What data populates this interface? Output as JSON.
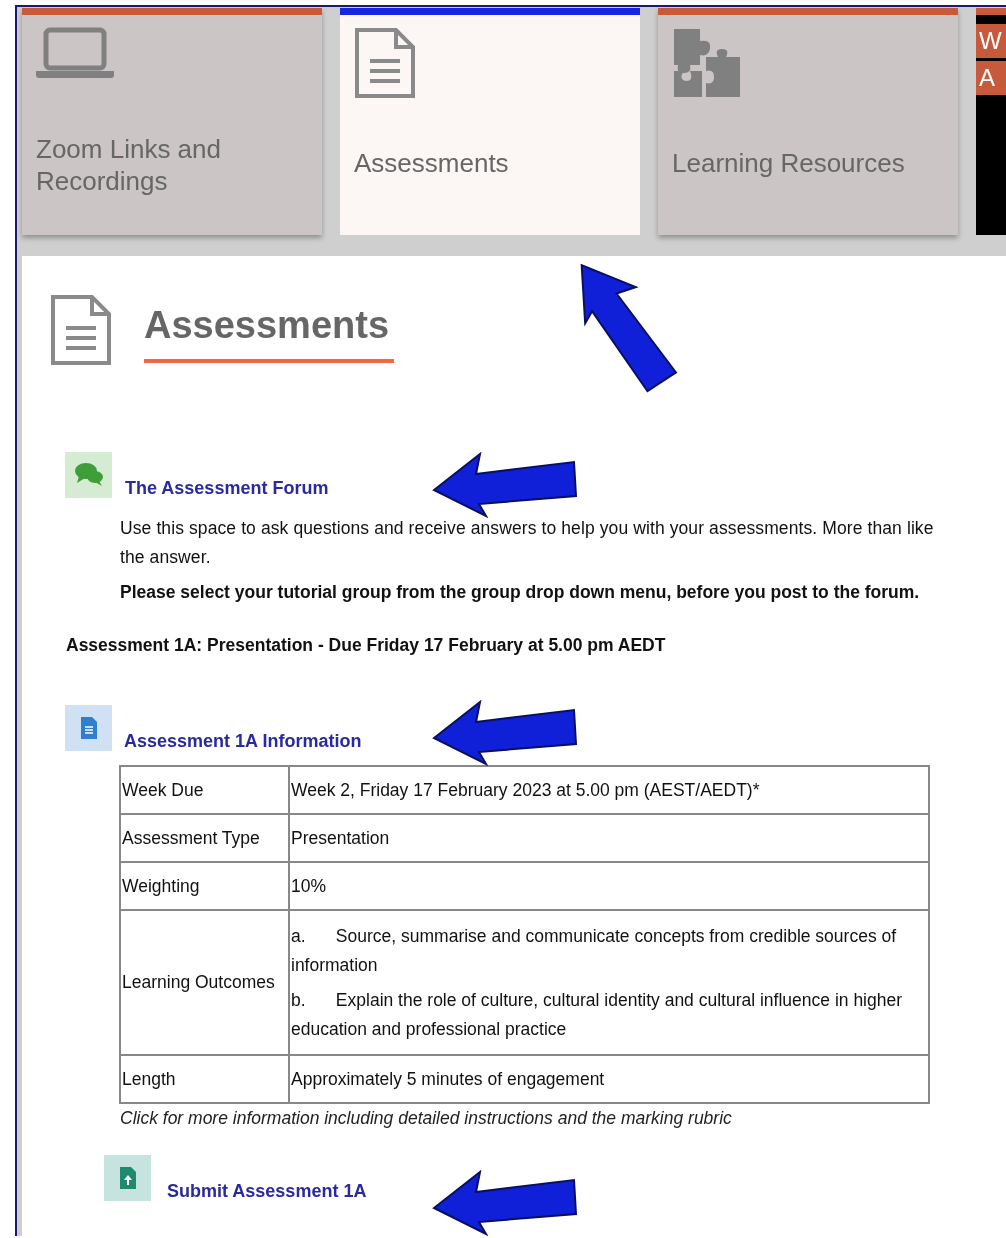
{
  "tabs": [
    {
      "kind": "laptop",
      "label": "Zoom Links and Recordings",
      "selected": false
    },
    {
      "kind": "page",
      "label": "Assessments",
      "selected": true
    },
    {
      "kind": "puzzle",
      "label": "Learning Resources",
      "selected": false
    },
    {
      "kind": "cut",
      "lines": [
        "W",
        "A"
      ],
      "selected": false
    }
  ],
  "heading": "Assessments",
  "forum": {
    "link": "The Assessment Forum",
    "lines": [
      "Use this space to ask questions and receive answers to help you with your assessments. More than like",
      "the answer."
    ],
    "notice": "Please select your tutorial group from the group drop down menu, before you post to the forum."
  },
  "assessment_title": "Assessment 1A: Presentation - Due Friday 17 February at 5.00 pm AEDT",
  "info_link": "Assessment 1A Information",
  "table": {
    "rows": [
      {
        "kind": "text",
        "label": "Week Due",
        "value": "Week 2, Friday 17 February 2023 at 5.00 pm (AEST/AEDT)*"
      },
      {
        "kind": "text",
        "label": "Assessment Type",
        "value": "Presentation"
      },
      {
        "kind": "text",
        "label": "Weighting",
        "value": "10%"
      },
      {
        "kind": "list",
        "label": "Learning Outcomes",
        "items": [
          {
            "marker": "a.",
            "text": "Source, summarise and communicate concepts from credible sources of information"
          },
          {
            "marker": "b.",
            "text": "Explain the role of culture, cultural identity and cultural influence in higher education and professional practice"
          }
        ]
      },
      {
        "kind": "text",
        "label": "Length",
        "value": "Approximately 5 minutes of engagement"
      }
    ]
  },
  "caption": "Click for more information including detailed instructions and the marking rubric",
  "submit_link": "Submit Assessment 1A"
}
